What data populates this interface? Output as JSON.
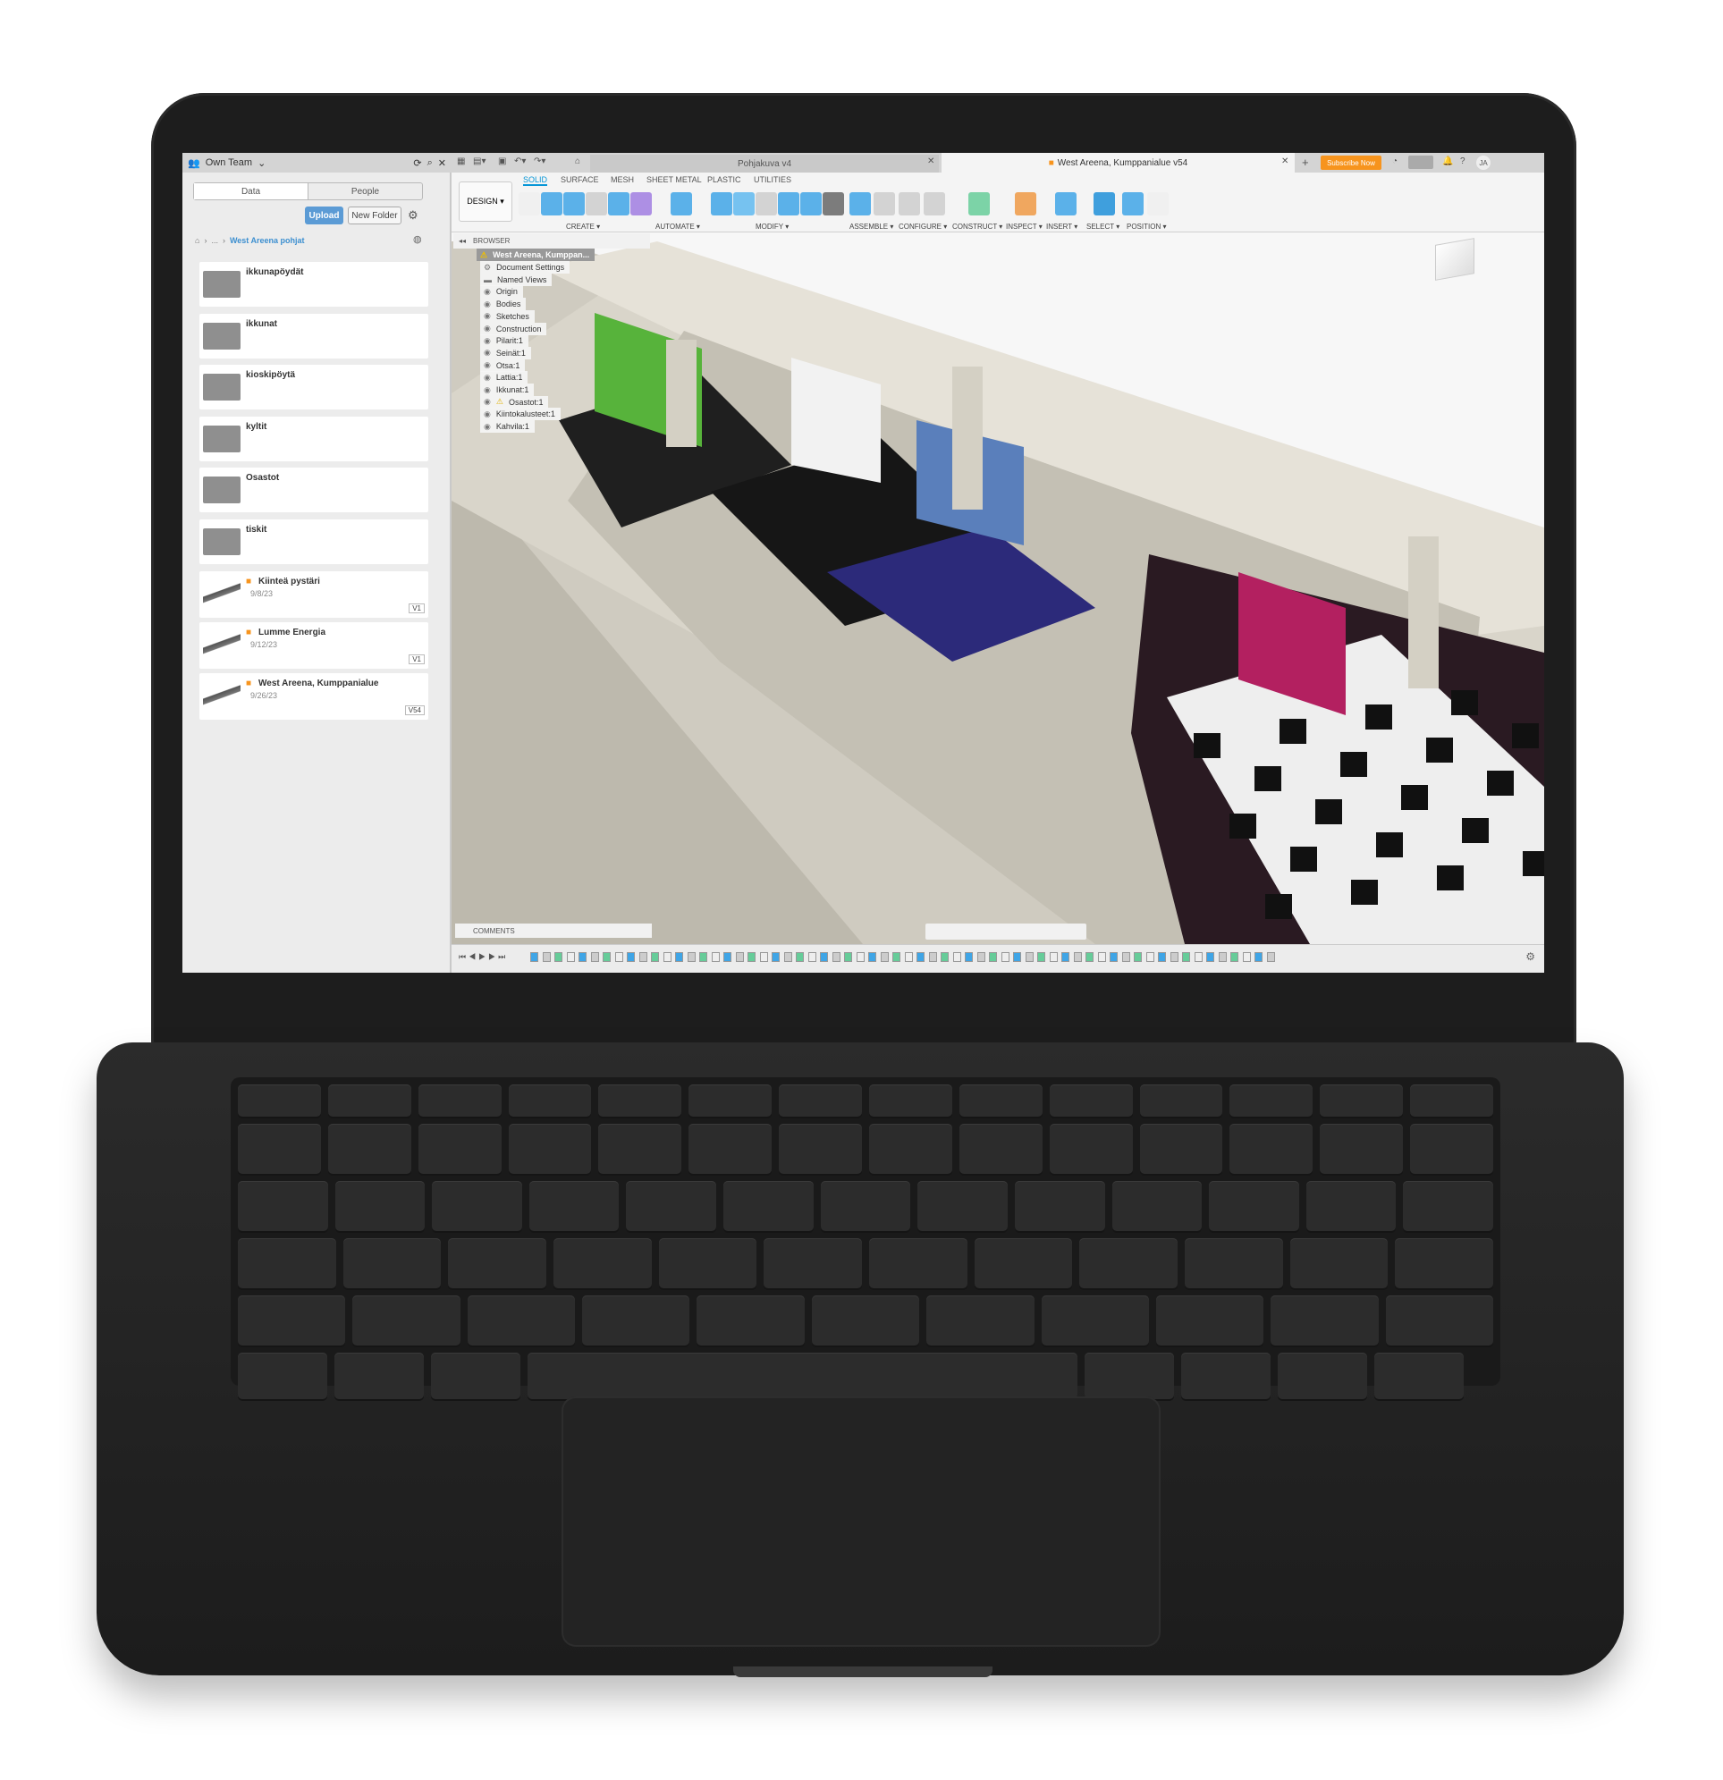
{
  "left_panel": {
    "team": "Own Team",
    "tabs": [
      "Data",
      "People"
    ],
    "upload": "Upload",
    "new_folder": "New Folder",
    "breadcrumb": {
      "ellipsis": "...",
      "current": "West Areena pohjat"
    },
    "folders": [
      "ikkunapöydät",
      "ikkunat",
      "kioskipöytä",
      "kyltit",
      "Osastot",
      "tiskit"
    ],
    "files": [
      {
        "name": "Kiinteä pystäri",
        "date": "9/8/23",
        "version": "V1"
      },
      {
        "name": "Lumme Energia",
        "date": "9/12/23",
        "version": "V1"
      },
      {
        "name": "West Areena, Kumppanialue",
        "date": "9/26/23",
        "version": "V54"
      }
    ]
  },
  "tabs": [
    {
      "label": "Pohjakuva v4"
    },
    {
      "label": "West Areena, Kumppanialue v54"
    }
  ],
  "subscribe": "Subscribe Now",
  "user_initials": "JA",
  "toolbar": {
    "workspace": "DESIGN ▾",
    "menu_tabs": [
      "SOLID",
      "SURFACE",
      "MESH",
      "SHEET METAL",
      "PLASTIC",
      "UTILITIES"
    ],
    "groups": [
      "CREATE ▾",
      "AUTOMATE ▾",
      "MODIFY ▾",
      "ASSEMBLE ▾",
      "CONFIGURE ▾",
      "CONSTRUCT ▾",
      "INSPECT ▾",
      "INSERT ▾",
      "SELECT ▾",
      "POSITION ▾"
    ]
  },
  "browser": {
    "title": "BROWSER",
    "root": "West Areena, Kumppan...",
    "nodes": [
      "Document Settings",
      "Named Views",
      "Origin",
      "Bodies",
      "Sketches",
      "Construction",
      "Pilarit:1",
      "Seinät:1",
      "Otsa:1",
      "Lattia:1",
      "Ikkunat:1",
      "Osastot:1",
      "Kiintokalusteet:1",
      "Kahvila:1"
    ]
  },
  "comments": "COMMENTS",
  "colors": {
    "accent": "#0696d7",
    "subscribe": "#f7941d",
    "upload": "#5b9bd5",
    "link": "#3c8fd0"
  }
}
